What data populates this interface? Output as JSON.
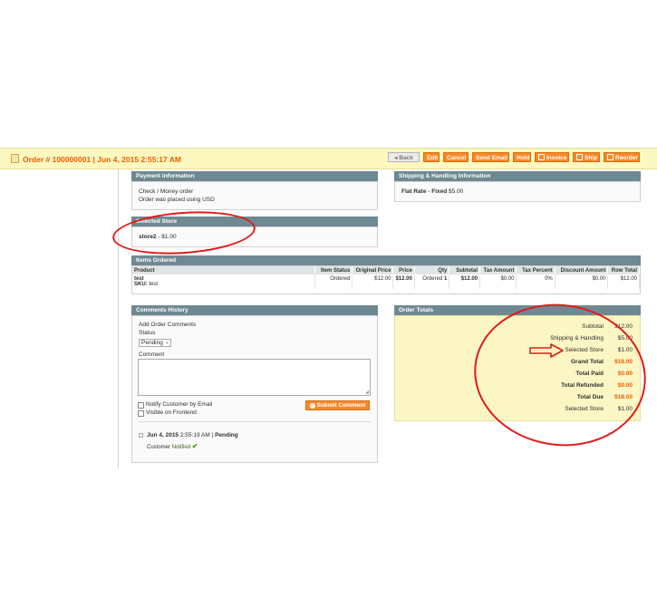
{
  "header": {
    "title": "Order # 100000001 | Jun 4, 2015 2:55:17 AM",
    "buttons": {
      "back": "Back",
      "edit": "Edit",
      "cancel": "Cancel",
      "send_email": "Send Email",
      "hold": "Hold",
      "invoice": "Invoice",
      "ship": "Ship",
      "reorder": "Reorder"
    }
  },
  "payment": {
    "title": "Payment Information",
    "method": "Check / Money order",
    "currency_note": "Order was placed using USD"
  },
  "shipping": {
    "title": "Shipping & Handling Information",
    "method_label": "Flat Rate - Fixed",
    "method_price": "$5.00"
  },
  "selected_store": {
    "title": "Selected Store",
    "store_name": "store2",
    "store_price": " - $1.00"
  },
  "items": {
    "title": "Items Ordered",
    "columns": [
      "Product",
      "Item Status",
      "Original Price",
      "Price",
      "Qty",
      "Subtotal",
      "Tax Amount",
      "Tax Percent",
      "Discount Amount",
      "Row Total"
    ],
    "rows": [
      {
        "product": "test",
        "sku_label": "SKU:",
        "sku": "test",
        "status": "Ordered",
        "original_price": "$12.00",
        "price": "$12.00",
        "qty_label": "Ordered",
        "qty": "1",
        "subtotal": "$12.00",
        "tax_amount": "$0.00",
        "tax_percent": "0%",
        "discount": "$0.00",
        "row_total": "$12.00"
      }
    ]
  },
  "comments": {
    "title": "Comments History",
    "add_label": "Add Order Comments",
    "status_label": "Status",
    "status_value": "Pending",
    "comment_label": "Comment",
    "notify_label": "Notify Customer by Email",
    "visible_label": "Visible on Frontend",
    "submit_label": "Submit Comment",
    "history": {
      "date": "Jun 4, 2015",
      "time": "2:55:19 AM",
      "separator": "|",
      "status": "Pending",
      "customer_label": "Customer",
      "notified": "Notified"
    }
  },
  "totals": {
    "title": "Order Totals",
    "rows": [
      {
        "label": "Subtotal",
        "value": "$12.00"
      },
      {
        "label": "Shipping & Handling",
        "value": "$5.00"
      },
      {
        "label": "Selected Store",
        "value": "$1.00"
      },
      {
        "label": "Grand Total",
        "value": "$18.00"
      },
      {
        "label": "Total Paid",
        "value": "$0.00"
      },
      {
        "label": "Total Refunded",
        "value": "$0.00"
      },
      {
        "label": "Total Due",
        "value": "$18.00"
      },
      {
        "label": "Selected Store",
        "value": "$1.00"
      }
    ]
  },
  "colors": {
    "accent": "#f6892a",
    "header_bg": "#fdf8c0",
    "box_head": "#6f8992",
    "annotation": "#e01b1b"
  }
}
